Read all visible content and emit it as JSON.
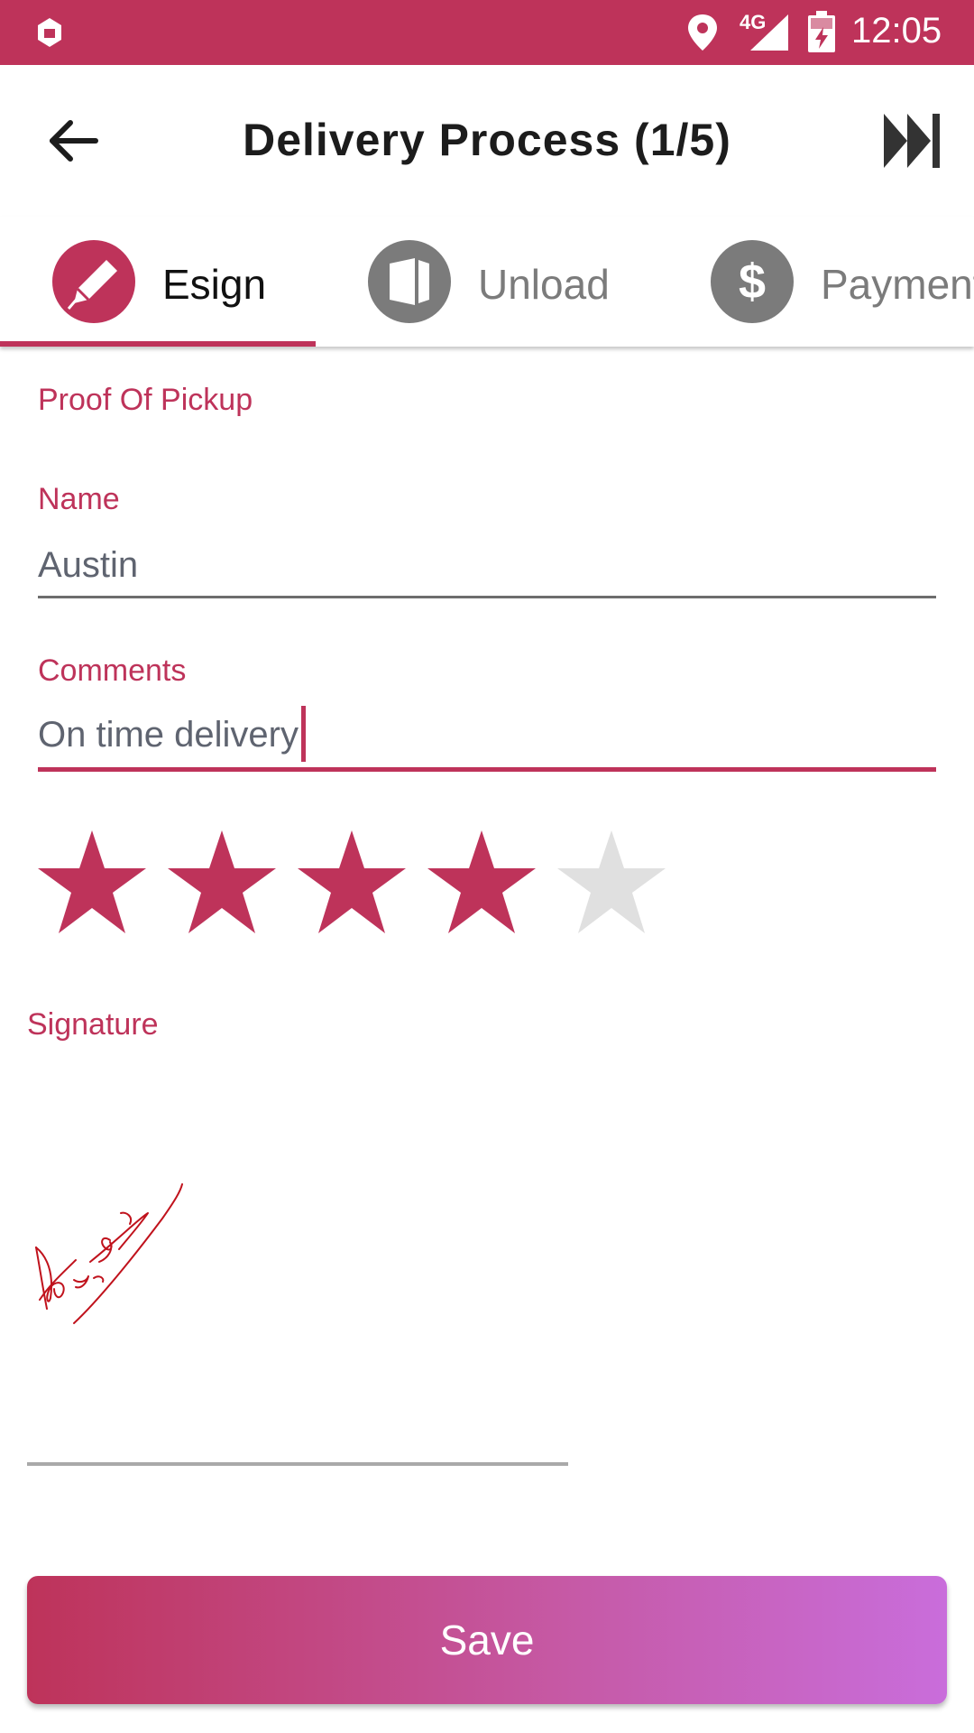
{
  "status_bar": {
    "network": "4G",
    "time": "12:05",
    "icons": [
      "app-icon",
      "location-icon",
      "signal-icon",
      "battery-charging-icon"
    ]
  },
  "app_bar": {
    "title": "Delivery Process (1/5)",
    "back_icon": "arrow-left-icon",
    "skip_icon": "skip-to-end-icon"
  },
  "tabs": [
    {
      "label": "Esign",
      "icon": "pen-icon",
      "active": true
    },
    {
      "label": "Unload",
      "icon": "box-icon",
      "active": false
    },
    {
      "label": "Payment",
      "icon": "dollar-icon",
      "active": false
    }
  ],
  "form": {
    "section_title": "Proof Of Pickup",
    "name": {
      "label": "Name",
      "value": "Austin"
    },
    "comments": {
      "label": "Comments",
      "value": "On time delivery"
    }
  },
  "rating": {
    "value": 4,
    "max": 5
  },
  "signature": {
    "label": "Signature"
  },
  "save_label": "Save",
  "colors": {
    "accent": "#be335a",
    "inactive": "#7b7b7b",
    "star_empty": "#e0e0e0",
    "signature_ink": "#c0121c",
    "button_gradient_end": "#c96ddb"
  }
}
